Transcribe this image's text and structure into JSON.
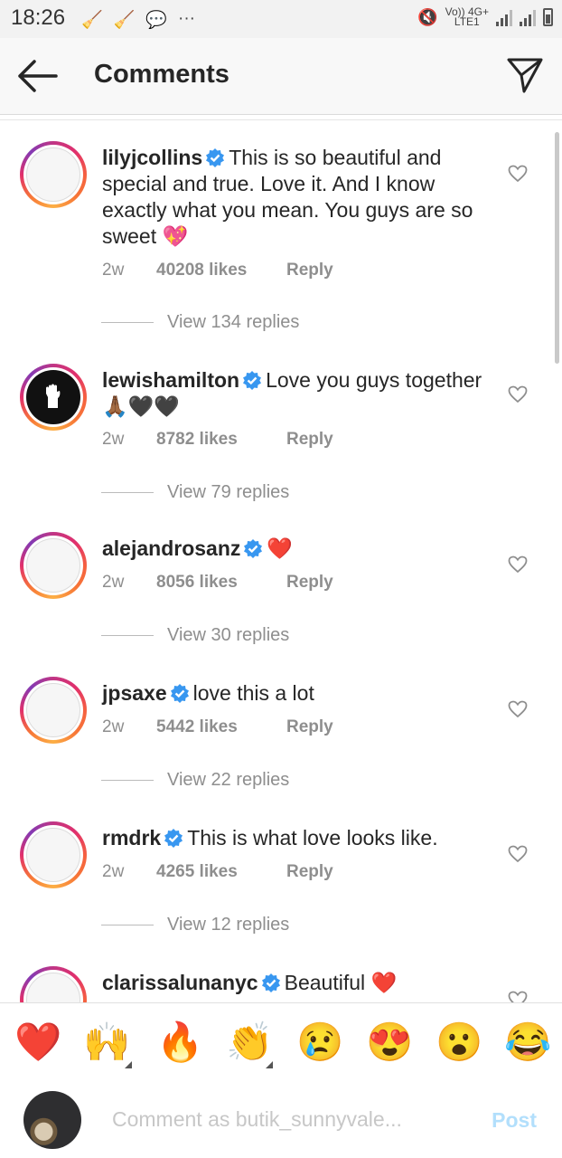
{
  "status_bar": {
    "time": "18:26",
    "network_top": "Vo)) 4G+",
    "network_bottom": "LTE1"
  },
  "header": {
    "title": "Comments",
    "back_icon": "back-arrow-icon",
    "send_icon": "direct-send-icon"
  },
  "comments": [
    {
      "username": "lilyjcollins",
      "text": "This is so beautiful and special and true. Love it. And I know exactly what you mean. You guys are so sweet",
      "emoji": "💖",
      "time": "2w",
      "likes": "40208 likes",
      "reply": "Reply",
      "view_replies": "View 134 replies"
    },
    {
      "username": "lewishamilton",
      "text": "Love you guys together",
      "emoji": "🙏🏾🖤🖤",
      "time": "2w",
      "likes": "8782 likes",
      "reply": "Reply",
      "view_replies": "View 79 replies"
    },
    {
      "username": "alejandrosanz",
      "text": "",
      "emoji": "❤️",
      "time": "2w",
      "likes": "8056 likes",
      "reply": "Reply",
      "view_replies": "View 30 replies"
    },
    {
      "username": "jpsaxe",
      "text": "love this a lot",
      "emoji": "",
      "time": "2w",
      "likes": "5442 likes",
      "reply": "Reply",
      "view_replies": "View 22 replies"
    },
    {
      "username": "rmdrk",
      "text": "This is what love looks like.",
      "emoji": "",
      "time": "2w",
      "likes": "4265 likes",
      "reply": "Reply",
      "view_replies": "View 12 replies"
    },
    {
      "username": "clarissalunanyc",
      "text": "Beautiful",
      "emoji": "❤️",
      "time": "",
      "likes": "",
      "reply": "",
      "view_replies": ""
    }
  ],
  "reactions": [
    "❤️",
    "🙌",
    "🔥",
    "👏",
    "😢",
    "😍",
    "😮",
    "😂"
  ],
  "composer": {
    "placeholder": "Comment as butik_sunnyvale...",
    "post_label": "Post"
  },
  "colors": {
    "verified": "#3897f0",
    "heart": "#ed4956",
    "post_disabled": "#b2dffc",
    "muted_text": "#8e8e8e"
  }
}
